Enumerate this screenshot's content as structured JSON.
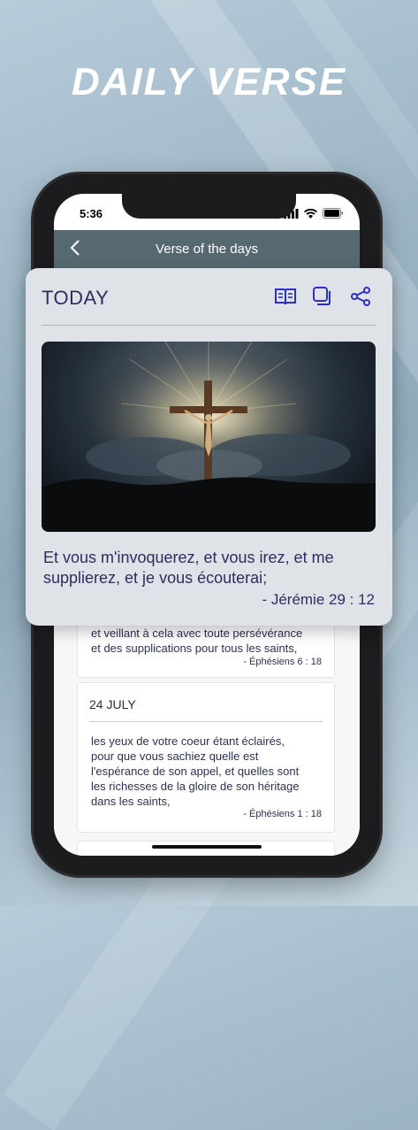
{
  "headline": "DAILY VERSE",
  "status_bar": {
    "time": "5:36"
  },
  "nav": {
    "title": "Verse of the days"
  },
  "today": {
    "title": "TODAY",
    "verse": "Et vous m'invoquerez, et vous irez, et me supplierez, et je vous écouterai;",
    "reference": "- Jérémie 29 : 12",
    "actions": [
      "book-icon",
      "copy-icon",
      "share-icon"
    ]
  },
  "verses": [
    {
      "date": "",
      "text_lines": [
        "et veillant à cela avec toute persévérance",
        "et des supplications pour tous les saints,"
      ],
      "reference": "- Éphésiens 6 : 18"
    },
    {
      "date": "24 JULY",
      "text_lines": [
        "les yeux de votre coeur étant éclairés,",
        "pour que vous sachiez quelle est",
        "l'espérance de son appel, et quelles sont",
        "les richesses de la gloire de son héritage",
        "dans les saints,"
      ],
      "reference": "- Éphésiens 1 : 18"
    }
  ],
  "colors": {
    "nav": "#566970",
    "accent": "#2b2fd0",
    "text": "#2b2f60"
  }
}
